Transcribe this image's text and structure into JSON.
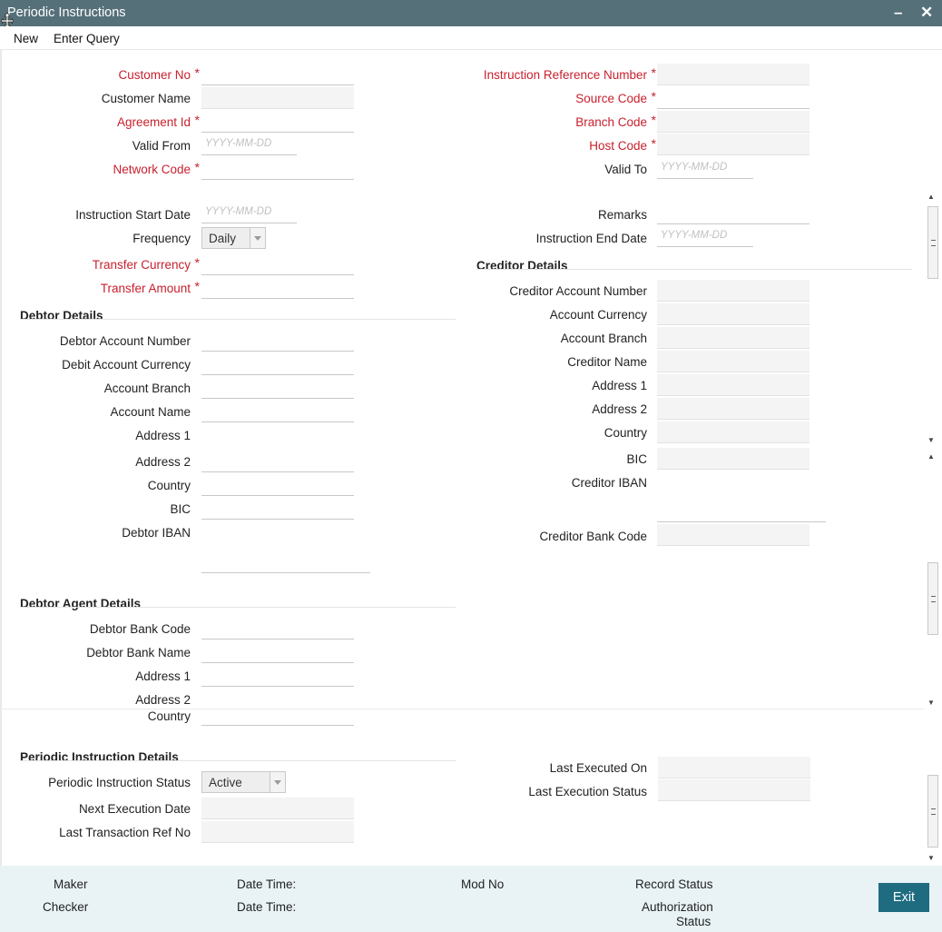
{
  "window": {
    "title": "Periodic Instructions",
    "minimize": "–",
    "close": "✕"
  },
  "menu": {
    "new": "New",
    "enter_query": "Enter Query"
  },
  "placeholder": "YYYY-MM-DD",
  "header": {
    "customer_no": "Customer No",
    "customer_name": "Customer Name",
    "agreement_id": "Agreement Id",
    "valid_from": "Valid From",
    "network_code": "Network Code",
    "instruction_reference_number": "Instruction Reference Number",
    "source_code": "Source Code",
    "branch_code": "Branch Code",
    "host_code": "Host Code",
    "valid_to": "Valid To"
  },
  "main": {
    "instruction_start_date": "Instruction Start Date",
    "frequency": "Frequency",
    "frequency_value": "Daily",
    "transfer_currency": "Transfer Currency",
    "transfer_amount": "Transfer Amount",
    "remarks": "Remarks",
    "instruction_end_date": "Instruction End Date"
  },
  "debtor": {
    "title": "Debtor Details",
    "account_number": "Debtor Account Number",
    "account_currency": "Debit Account Currency",
    "account_branch": "Account Branch",
    "account_name": "Account Name",
    "address1": "Address 1",
    "address2": "Address 2",
    "country": "Country",
    "bic": "BIC",
    "iban": "Debtor IBAN"
  },
  "creditor": {
    "title": "Creditor Details",
    "account_number": "Creditor Account Number",
    "account_currency": "Account Currency",
    "account_branch": "Account Branch",
    "name": "Creditor Name",
    "address1": "Address 1",
    "address2": "Address 2",
    "country": "Country",
    "bic": "BIC",
    "iban": "Creditor IBAN",
    "bank_code": "Creditor Bank Code"
  },
  "debtor_agent": {
    "title": "Debtor Agent Details",
    "bank_code": "Debtor Bank Code",
    "bank_name": "Debtor Bank Name",
    "address1": "Address 1",
    "address2": "Address 2",
    "country": "Country"
  },
  "periodic": {
    "title": "Periodic Instruction Details",
    "status": "Periodic Instruction Status",
    "status_value": "Active",
    "next_execution_date": "Next Execution Date",
    "last_transaction_ref": "Last Transaction Ref No",
    "last_executed_on": "Last Executed On",
    "last_execution_status": "Last Execution Status"
  },
  "footer": {
    "maker": "Maker",
    "checker": "Checker",
    "date_time_1": "Date Time:",
    "date_time_2": "Date Time:",
    "mod_no": "Mod No",
    "record_status": "Record Status",
    "authorization_status_1": "Authorization",
    "authorization_status_2": "Status",
    "exit": "Exit"
  },
  "colors": {
    "title_bar": "#56707a",
    "required": "#c8202e",
    "footer": "#e9f3f5",
    "exit_button": "#1f6b80"
  }
}
